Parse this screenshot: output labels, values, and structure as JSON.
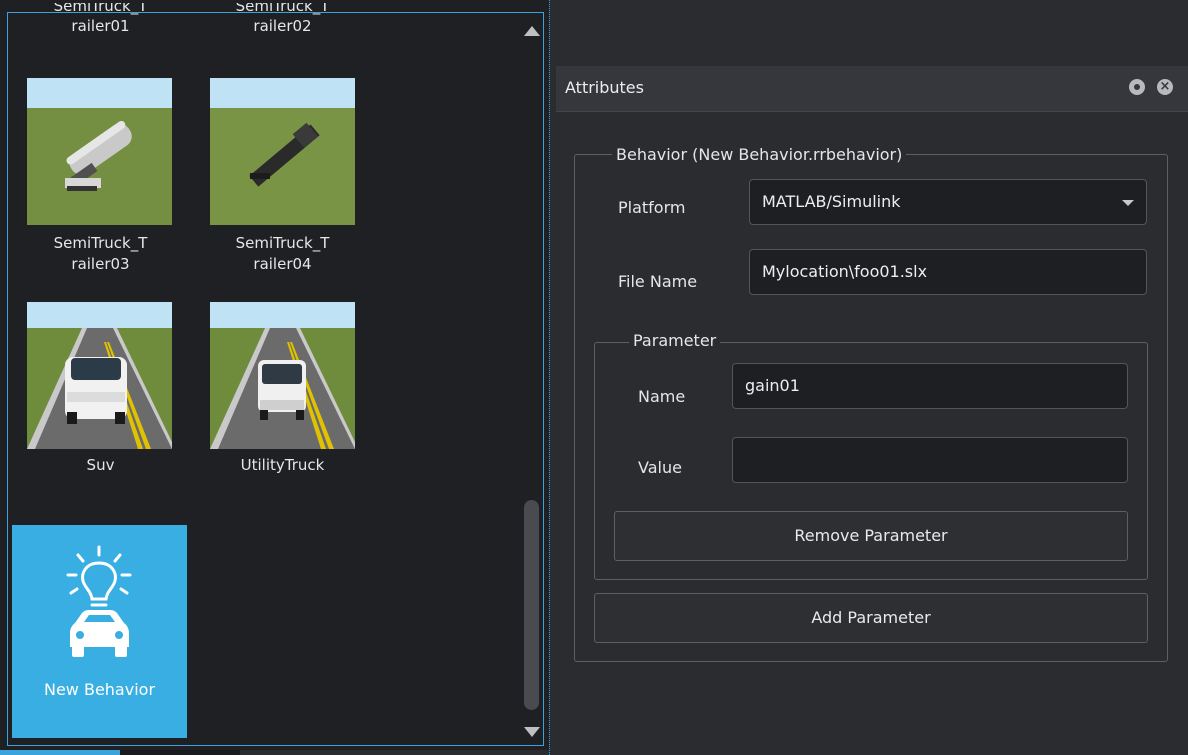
{
  "browser": {
    "items": [
      {
        "label_line1": "SemiTruck_T",
        "label_line2": "railer01"
      },
      {
        "label_line1": "SemiTruck_T",
        "label_line2": "railer02"
      },
      {
        "label_line1": "SemiTruck_T",
        "label_line2": "railer03"
      },
      {
        "label_line1": "SemiTruck_T",
        "label_line2": "railer04"
      },
      {
        "label_line1": "Suv",
        "label_line2": ""
      },
      {
        "label_line1": "UtilityTruck",
        "label_line2": ""
      }
    ],
    "new_behavior": {
      "label": "New Behavior",
      "icon": "behavior-bulb-car-icon"
    },
    "accent_color": "#38aee3"
  },
  "attributes": {
    "title": "Attributes",
    "behavior_group": {
      "legend": "Behavior (New Behavior.rrbehavior)",
      "platform_label": "Platform",
      "platform_value": "MATLAB/Simulink",
      "file_name_label": "File Name",
      "file_name_value": "Mylocation\\foo01.slx"
    },
    "parameter_group": {
      "legend": "Parameter",
      "name_label": "Name",
      "name_value": "gain01",
      "value_label": "Value",
      "value_value": "",
      "remove_button": "Remove Parameter"
    },
    "add_button": "Add Parameter"
  }
}
